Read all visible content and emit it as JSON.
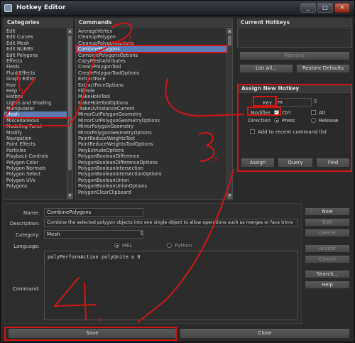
{
  "window": {
    "title": "Hotkey Editor",
    "min": "_",
    "max": "□",
    "close": "✕"
  },
  "categories": {
    "header": "Categories",
    "items": [
      "Edit",
      "Edit Curves",
      "Edit Mesh",
      "Edit NURBS",
      "Edit Polygons",
      "Effects",
      "Fields",
      "Fluid Effects",
      "Graph Editor",
      "Hair",
      "Help",
      "Hotbox",
      "Lights and Shading",
      "Manipulator",
      "Mesh",
      "Miscellaneous",
      "Modeling Panel",
      "Modify",
      "Navigation",
      "Paint Effects",
      "Particles",
      "Playback Controls",
      "Polygon Color",
      "Polygon Normals",
      "Polygon Select",
      "Polygon UVs",
      "Polygons"
    ],
    "selected_index": 14
  },
  "commands": {
    "header": "Commands",
    "items": [
      "AverageVertex",
      "CleanupPolygon",
      "CleanupPolygonOptions",
      "CombinePolygons",
      "CombinePolygonsOptions",
      "CopyMeshAttributes",
      "CreatePolygonTool",
      "CreatePolygonToolOptions",
      "ExtractFace",
      "ExtractFaceOptions",
      "FillHole",
      "MakeHoleTool",
      "MakeHoleToolOptions",
      "MakeUVInstanceCurrent",
      "MirrorCutPolygonGeometry",
      "MirrorCutPolygonGeometryOptions",
      "MirrorPolygonGeometry",
      "MirrorPolygonGeometryOptions",
      "PaintReduceWeightsTool",
      "PaintReduceWeightsToolOptions",
      "PolyExtrudeOptions",
      "PolygonBooleanDifference",
      "PolygonBooleanDifferenceOptions",
      "PolygonBooleanIntersection",
      "PolygonBooleanIntersectionOptions",
      "PolygonBooleanUnion",
      "PolygonBooleanUnionOptions",
      "PolygonClearClipboard"
    ],
    "selected_index": 3
  },
  "current_hotkeys": {
    "header": "Current Hotkeys",
    "remove": "Remove",
    "list_all": "List All...",
    "restore": "Restore Defaults"
  },
  "assign": {
    "header": "Assign New Hotkey",
    "key_label": "Key",
    "key_value": "m",
    "modifier_label": "Modifier",
    "ctrl_label": "Ctrl",
    "ctrl_checked": true,
    "alt_label": "Alt",
    "alt_checked": false,
    "direction_label": "Direction",
    "press_label": "Press",
    "release_label": "Release",
    "direction_value": "Press",
    "recent_label": "Add to recent command list",
    "recent_checked": false,
    "assign_btn": "Assign",
    "query_btn": "Query",
    "find_btn": "Find"
  },
  "details": {
    "name_label": "Name:",
    "name_value": "CombinePolygons",
    "desc_label": "Description:",
    "desc_value": "Combine the selected polygon objects into one single object to allow operations such as merges or face trims",
    "category_label": "Category:",
    "category_value": "Mesh",
    "language_label": "Language:",
    "mel_label": "MEL",
    "python_label": "Python",
    "language_value": "MEL",
    "command_label": "Command:",
    "command_value": "polyPerformAction polyUnite o 0"
  },
  "side_buttons": {
    "new": "New",
    "edit": "Edit",
    "delete": "Delete",
    "accept": "Accept",
    "cancel": "Cancel",
    "search": "Search...",
    "help": "Help"
  },
  "bottom": {
    "save": "Save",
    "close": "Close"
  },
  "annotations": {
    "color": "#d01515",
    "step1": "1.",
    "step2": "2.",
    "step3": "3.",
    "step4": "4."
  }
}
